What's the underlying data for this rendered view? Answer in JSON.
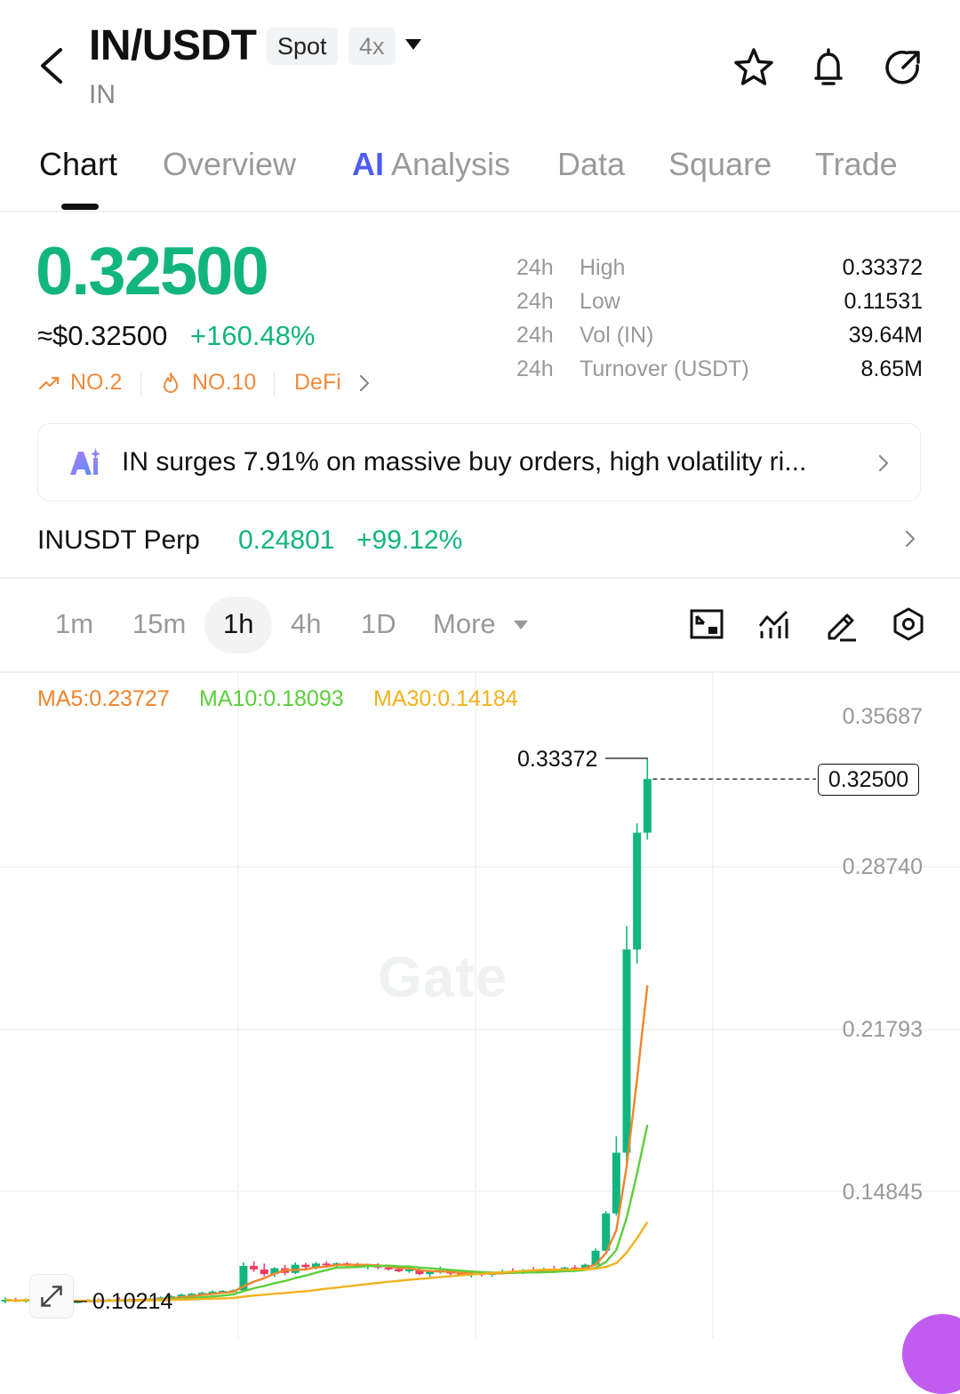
{
  "header": {
    "pair": "IN/USDT",
    "market_badge": "Spot",
    "leverage_badge": "4x",
    "subtitle": "IN"
  },
  "tabs": [
    {
      "label": "Chart",
      "active": true
    },
    {
      "label": "Overview"
    },
    {
      "label": "Analysis",
      "ai_badge": "AI"
    },
    {
      "label": "Data"
    },
    {
      "label": "Square"
    },
    {
      "label": "Trade"
    }
  ],
  "price": {
    "last": "0.32500",
    "usd": "≈$0.32500",
    "change": "+160.48%"
  },
  "tags": [
    {
      "label": "NO.2",
      "icon": "trend-up-icon"
    },
    {
      "label": "NO.10",
      "icon": "flame-icon"
    },
    {
      "label": "DeFi"
    }
  ],
  "stats": [
    {
      "period": "24h",
      "label": "High",
      "value": "0.33372"
    },
    {
      "period": "24h",
      "label": "Low",
      "value": "0.11531"
    },
    {
      "period": "24h",
      "label": "Vol (IN)",
      "value": "39.64M"
    },
    {
      "period": "24h",
      "label": "Turnover (USDT)",
      "value": "8.65M"
    }
  ],
  "news": {
    "text": "IN surges 7.91% on massive buy orders, high volatility ri..."
  },
  "perp": {
    "name": "INUSDT Perp",
    "price": "0.24801",
    "change": "+99.12%"
  },
  "timeframes": {
    "items": [
      "1m",
      "15m",
      "1h",
      "4h",
      "1D"
    ],
    "active": "1h",
    "more_label": "More"
  },
  "chart_data": {
    "type": "candlestick",
    "moving_averages": [
      {
        "name": "MA5",
        "label": "MA5:0.23727",
        "color": "#f0852d"
      },
      {
        "name": "MA10",
        "label": "MA10:0.18093",
        "color": "#5ccf3a"
      },
      {
        "name": "MA30",
        "label": "MA30:0.14184",
        "color": "#f2b21f"
      }
    ],
    "y_ticks": [
      "0.35687",
      "0.28740",
      "0.21793",
      "0.14845"
    ],
    "last_price": "0.32500",
    "high_marker": "0.33372",
    "low_marker": "0.10214",
    "watermark": "Gate",
    "colors": {
      "up": "#12b57e",
      "down": "#f03c64"
    },
    "candles": [
      {
        "o": 0.1015,
        "h": 0.103,
        "l": 0.1005,
        "c": 0.102
      },
      {
        "o": 0.102,
        "h": 0.1028,
        "l": 0.101,
        "c": 0.1012
      },
      {
        "o": 0.1012,
        "h": 0.1025,
        "l": 0.1008,
        "c": 0.1022
      },
      {
        "o": 0.1022,
        "h": 0.103,
        "l": 0.1015,
        "c": 0.1018
      },
      {
        "o": 0.1018,
        "h": 0.1024,
        "l": 0.101,
        "c": 0.1015
      },
      {
        "o": 0.1015,
        "h": 0.1022,
        "l": 0.1009,
        "c": 0.1013
      },
      {
        "o": 0.1013,
        "h": 0.102,
        "l": 0.1006,
        "c": 0.101
      },
      {
        "o": 0.101,
        "h": 0.1018,
        "l": 0.1004,
        "c": 0.1014
      },
      {
        "o": 0.1014,
        "h": 0.1022,
        "l": 0.101,
        "c": 0.1018
      },
      {
        "o": 0.1018,
        "h": 0.1026,
        "l": 0.1012,
        "c": 0.1016
      },
      {
        "o": 0.1016,
        "h": 0.1024,
        "l": 0.1012,
        "c": 0.1021
      },
      {
        "o": 0.1021,
        "h": 0.103,
        "l": 0.1015,
        "c": 0.1019
      },
      {
        "o": 0.1019,
        "h": 0.1026,
        "l": 0.1012,
        "c": 0.1017
      },
      {
        "o": 0.1017,
        "h": 0.1025,
        "l": 0.1013,
        "c": 0.1023
      },
      {
        "o": 0.1023,
        "h": 0.1032,
        "l": 0.1018,
        "c": 0.1025
      },
      {
        "o": 0.1025,
        "h": 0.1034,
        "l": 0.102,
        "c": 0.103
      },
      {
        "o": 0.103,
        "h": 0.104,
        "l": 0.1025,
        "c": 0.1035
      },
      {
        "o": 0.1035,
        "h": 0.1046,
        "l": 0.103,
        "c": 0.1042
      },
      {
        "o": 0.1042,
        "h": 0.105,
        "l": 0.1036,
        "c": 0.1046
      },
      {
        "o": 0.1046,
        "h": 0.1055,
        "l": 0.104,
        "c": 0.105
      },
      {
        "o": 0.105,
        "h": 0.106,
        "l": 0.1043,
        "c": 0.1055
      },
      {
        "o": 0.1055,
        "h": 0.1062,
        "l": 0.1048,
        "c": 0.1058
      },
      {
        "o": 0.1058,
        "h": 0.1065,
        "l": 0.105,
        "c": 0.106
      },
      {
        "o": 0.106,
        "h": 0.118,
        "l": 0.1055,
        "c": 0.1165
      },
      {
        "o": 0.1165,
        "h": 0.1185,
        "l": 0.114,
        "c": 0.115
      },
      {
        "o": 0.115,
        "h": 0.1175,
        "l": 0.112,
        "c": 0.113
      },
      {
        "o": 0.113,
        "h": 0.116,
        "l": 0.1118,
        "c": 0.1155
      },
      {
        "o": 0.1155,
        "h": 0.117,
        "l": 0.1125,
        "c": 0.1135
      },
      {
        "o": 0.1135,
        "h": 0.118,
        "l": 0.113,
        "c": 0.117
      },
      {
        "o": 0.117,
        "h": 0.1178,
        "l": 0.115,
        "c": 0.116
      },
      {
        "o": 0.116,
        "h": 0.1182,
        "l": 0.115,
        "c": 0.1175
      },
      {
        "o": 0.1175,
        "h": 0.1185,
        "l": 0.116,
        "c": 0.1168
      },
      {
        "o": 0.1168,
        "h": 0.118,
        "l": 0.116,
        "c": 0.1176
      },
      {
        "o": 0.1176,
        "h": 0.1182,
        "l": 0.1162,
        "c": 0.117
      },
      {
        "o": 0.117,
        "h": 0.1178,
        "l": 0.1155,
        "c": 0.1162
      },
      {
        "o": 0.1162,
        "h": 0.1175,
        "l": 0.115,
        "c": 0.117
      },
      {
        "o": 0.117,
        "h": 0.1176,
        "l": 0.115,
        "c": 0.1158
      },
      {
        "o": 0.1158,
        "h": 0.1168,
        "l": 0.1145,
        "c": 0.1152
      },
      {
        "o": 0.1152,
        "h": 0.1164,
        "l": 0.1138,
        "c": 0.1142
      },
      {
        "o": 0.1142,
        "h": 0.116,
        "l": 0.1135,
        "c": 0.115
      },
      {
        "o": 0.115,
        "h": 0.1158,
        "l": 0.1125,
        "c": 0.113
      },
      {
        "o": 0.113,
        "h": 0.1148,
        "l": 0.1118,
        "c": 0.114
      },
      {
        "o": 0.114,
        "h": 0.1162,
        "l": 0.1132,
        "c": 0.1145
      },
      {
        "o": 0.1145,
        "h": 0.1152,
        "l": 0.1126,
        "c": 0.1132
      },
      {
        "o": 0.1132,
        "h": 0.1145,
        "l": 0.1122,
        "c": 0.1128
      },
      {
        "o": 0.1128,
        "h": 0.114,
        "l": 0.1115,
        "c": 0.1135
      },
      {
        "o": 0.1135,
        "h": 0.1142,
        "l": 0.112,
        "c": 0.1127
      },
      {
        "o": 0.1127,
        "h": 0.114,
        "l": 0.1118,
        "c": 0.1136
      },
      {
        "o": 0.1136,
        "h": 0.115,
        "l": 0.1128,
        "c": 0.1142
      },
      {
        "o": 0.1142,
        "h": 0.1155,
        "l": 0.1132,
        "c": 0.1138
      },
      {
        "o": 0.1138,
        "h": 0.1152,
        "l": 0.113,
        "c": 0.1146
      },
      {
        "o": 0.1146,
        "h": 0.116,
        "l": 0.1136,
        "c": 0.114
      },
      {
        "o": 0.114,
        "h": 0.1158,
        "l": 0.1135,
        "c": 0.1152
      },
      {
        "o": 0.1152,
        "h": 0.1165,
        "l": 0.1142,
        "c": 0.1148
      },
      {
        "o": 0.1148,
        "h": 0.1162,
        "l": 0.114,
        "c": 0.1158
      },
      {
        "o": 0.1158,
        "h": 0.1168,
        "l": 0.1145,
        "c": 0.115
      },
      {
        "o": 0.115,
        "h": 0.1175,
        "l": 0.1146,
        "c": 0.117
      },
      {
        "o": 0.117,
        "h": 0.124,
        "l": 0.1165,
        "c": 0.123
      },
      {
        "o": 0.123,
        "h": 0.14,
        "l": 0.1225,
        "c": 0.139
      },
      {
        "o": 0.139,
        "h": 0.172,
        "l": 0.138,
        "c": 0.165
      },
      {
        "o": 0.165,
        "h": 0.262,
        "l": 0.16,
        "c": 0.252
      },
      {
        "o": 0.252,
        "h": 0.306,
        "l": 0.246,
        "c": 0.302
      },
      {
        "o": 0.302,
        "h": 0.3337,
        "l": 0.299,
        "c": 0.325
      }
    ]
  }
}
